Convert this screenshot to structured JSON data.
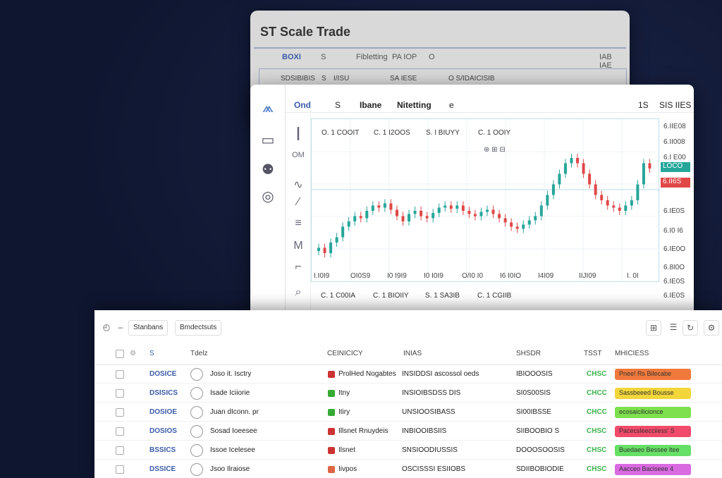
{
  "back_window": {
    "title": "ST Scale Trade",
    "toolbar": [
      "BOXI",
      "S",
      "Fibletting",
      "PA IOP",
      "O"
    ],
    "toolbar_right": "IAB IAE",
    "sub": [
      "SDSIBIBIS",
      "S",
      "I/ISU",
      "SA IESE",
      "O S/IDAICISIB"
    ]
  },
  "chart_window": {
    "tabs": [
      "Ond",
      "S",
      "Ibane",
      "Nitetting",
      "e"
    ],
    "top_right": [
      "1S",
      "SIS IIES"
    ],
    "left_label": "OM",
    "ohlc": [
      "O. 1 COOIT",
      "C. 1 I2OOS",
      "S. I BIUYY",
      "C. 1 OOIY"
    ],
    "price_labels": [
      "6.IIE08",
      "6.II008",
      "6.I E00",
      "6.IE0S",
      "6.I0 I6",
      "6.IE0O",
      "6.8I0O",
      "6.IE0S",
      "6.IE0S"
    ],
    "price_tag_green": "LOCO",
    "price_tag_red": "6.II6S",
    "time_labels": [
      "I.I0I9",
      "OI0S9",
      "I0 I9I9",
      "I0 I0I9",
      "O/I0 I0",
      "I6 I0IO",
      "I4I09",
      "IIJI09",
      "I. 0I"
    ],
    "bottom": [
      "C. 1 C00IA",
      "C. 1 BIOIIY",
      "S. 1 SA3IB",
      "C. 1 CGIIB"
    ],
    "colors": {
      "up": "#26a69a",
      "down": "#e04848"
    },
    "chart_data": {
      "type": "candlestick",
      "values": [
        6.5,
        6.45,
        6.55,
        6.6,
        6.7,
        6.75,
        6.8,
        6.78,
        6.85,
        6.9,
        6.88,
        6.92,
        6.86,
        6.8,
        6.75,
        6.82,
        6.85,
        6.8,
        6.78,
        6.83,
        6.88,
        6.9,
        6.87,
        6.9,
        6.85,
        6.82,
        6.8,
        6.84,
        6.86,
        6.82,
        6.78,
        6.74,
        6.7,
        6.68,
        6.72,
        6.76,
        6.8,
        6.9,
        7.0,
        7.1,
        7.2,
        7.3,
        7.35,
        7.3,
        7.2,
        7.1,
        7.0,
        6.95,
        6.9,
        6.88,
        6.85,
        6.9,
        6.95,
        7.1,
        7.3,
        7.25
      ]
    }
  },
  "table": {
    "toolbar_buttons": [
      "Stanbans",
      "Bmdectsuts"
    ],
    "headers": [
      "S",
      "Tdelz",
      "CEINICICY",
      "INIAS",
      "SHSDR",
      "TSST",
      "MHICIESS"
    ],
    "rows": [
      {
        "sym": "DOSICE",
        "name": "Joso it. Isctry",
        "flag": "#c33",
        "company": "ProlHed Nogabtes",
        "desc": "INSIDDSI ascossol oeds",
        "num": "IBIOOOSIS",
        "status": "CHSC",
        "tag": "Pnee! Rs Bilecabe",
        "tagcolor": "#f07a3c"
      },
      {
        "sym": "DSISICS",
        "name": "Isade Iciiorie",
        "flag": "#3a3",
        "company": "Itny",
        "desc": "INSIOIBSDSS DIS",
        "num": "SI0S00SIS",
        "status": "CHCC",
        "tag": "Sassbeeed Bousse",
        "tagcolor": "#f2d63a"
      },
      {
        "sym": "DOSIOE",
        "name": "Juan dIconn. pr",
        "flag": "#3a3",
        "company": "Itiry",
        "desc": "UNSIOOSIBASS",
        "num": "SI00IBSSE",
        "status": "CHCC",
        "tag": "ecosaicilicionce",
        "tagcolor": "#7de04c"
      },
      {
        "sym": "DOSIOS",
        "name": "Sosad Ioeesee",
        "flag": "#c33",
        "company": "Illsnet Rnuydeis",
        "desc": "INBIOOIBSIIS",
        "num": "SIIBOOBIO S",
        "status": "CHSC",
        "tag": "Pacecsleecciiess' S",
        "tagcolor": "#f24a6a"
      },
      {
        "sym": "BSSICS",
        "name": "Issoe Icelesee",
        "flag": "#c33",
        "company": "Ilsnet",
        "desc": "SNSIOODIUSSIS",
        "num": "DOOOSOOSIS",
        "status": "CHSC",
        "tag": "Buedaeo Bessee ltee",
        "tagcolor": "#66e066"
      },
      {
        "sym": "DSSICE",
        "name": "Jsoo Ilraiose",
        "flag": "#d64",
        "company": "Iivpos",
        "desc": "OSCISSSI ESIIOBS",
        "num": "SDIIBOBIODIE",
        "status": "CHSC",
        "tag": "Aacceo Baciseee 4",
        "tagcolor": "#d96ae0"
      }
    ]
  }
}
